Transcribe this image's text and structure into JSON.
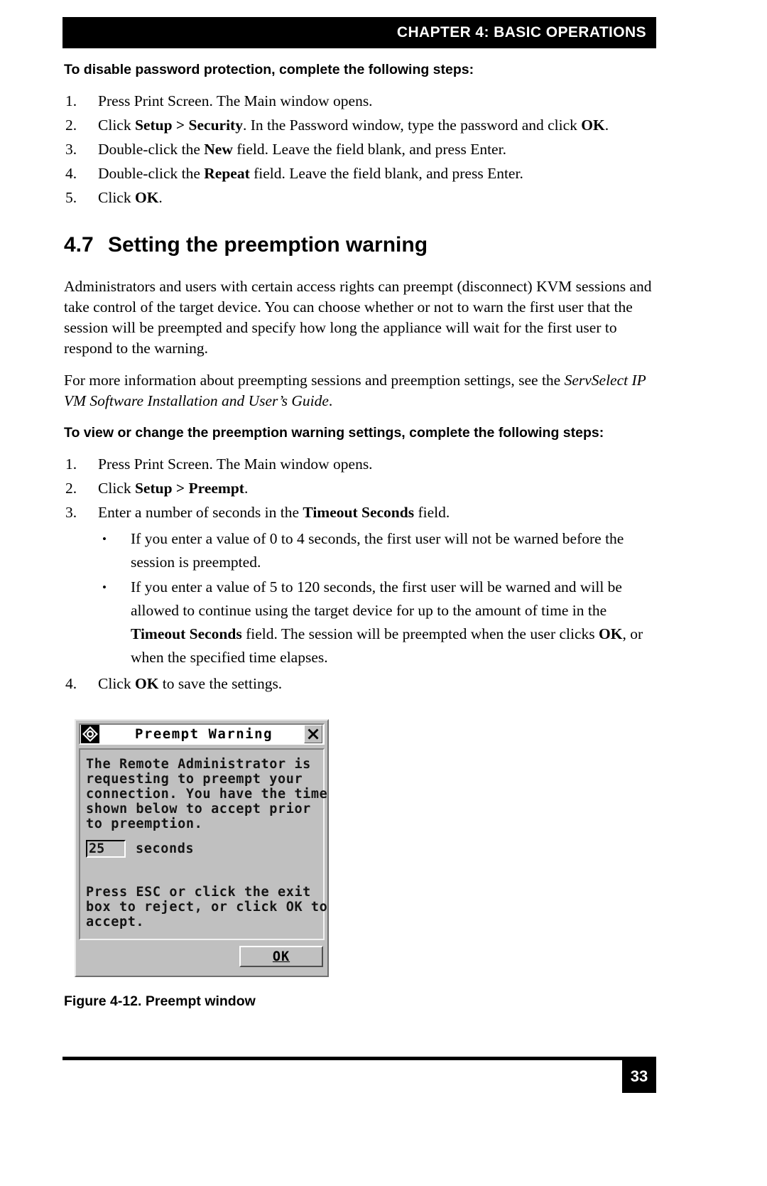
{
  "header": {
    "chapter_title": "CHAPTER 4: BASIC OPERATIONS"
  },
  "section_password": {
    "heading": "To disable password protection, complete the following steps:",
    "steps": [
      {
        "marker": "1.",
        "pre": "Press Print Screen. The Main window opens.",
        "bold": "",
        "post": ""
      },
      {
        "marker": "2.",
        "pre": "Click ",
        "bold": "Setup > Security",
        "mid": ". In the Password window, type the password and click ",
        "bold2": "OK",
        "post": "."
      },
      {
        "marker": "3.",
        "pre": "Double-click the ",
        "bold": "New",
        "post": " field. Leave the field blank, and press Enter."
      },
      {
        "marker": "4.",
        "pre": "Double-click the ",
        "bold": "Repeat",
        "post": " field. Leave the field blank, and press Enter."
      },
      {
        "marker": "5.",
        "pre": "Click ",
        "bold": "OK",
        "post": "."
      }
    ]
  },
  "section_47": {
    "number": "4.7",
    "title": "Setting the preemption warning",
    "paragraph_1": "Administrators and users with certain access rights can preempt (disconnect) KVM sessions and take control of the target device. You can choose whether or not to warn the first user that the session will be preempted and specify how long the appliance will wait for the first user to respond to the warning.",
    "paragraph_2_pre": "For more information about preempting sessions and preemption settings, see the ",
    "paragraph_2_italic": "ServSelect IP VM Software Installation and User’s Guide",
    "paragraph_2_post": ".",
    "procedure_heading": "To view or change the preemption warning settings, complete the following steps:",
    "steps": [
      {
        "marker": "1.",
        "pre": "Press Print Screen. The Main window opens.",
        "bold": "",
        "post": ""
      },
      {
        "marker": "2.",
        "pre": "Click ",
        "bold": "Setup > Preempt",
        "post": "."
      },
      {
        "marker": "3.",
        "pre": "Enter a number of seconds in the ",
        "bold": "Timeout Seconds",
        "post": " field."
      }
    ],
    "sub_bullets": [
      {
        "bullet": "•",
        "text": "If you enter a value of 0 to 4 seconds, the first user will not be warned before the session is preempted."
      },
      {
        "bullet": "•",
        "pre": "If you enter a value of 5 to 120 seconds, the first user will be warned and will be allowed to continue using the target device for up to the amount of time in the ",
        "bold": "Timeout Seconds",
        "mid": " field. The session will be preempted when the user clicks ",
        "bold2": "OK",
        "post": ", or when the specified time elapses."
      }
    ],
    "final_step": {
      "marker": "4.",
      "pre": "Click ",
      "bold": "OK",
      "post": " to save the settings."
    }
  },
  "dialog": {
    "title": "Preempt Warning",
    "system_icon": "diamond-logo-icon",
    "close_icon": "close-x-icon",
    "message_lines": "The Remote Administrator is\nrequesting to preempt your\nconnection. You have the time\nshown below to accept prior\nto preemption.",
    "timeout_value": "25",
    "timeout_unit": "seconds",
    "instruction_lines": "Press ESC or click the exit\nbox to reject, or click OK to\naccept.",
    "ok_label": "OK"
  },
  "figure": {
    "caption_number": "Figure 4-12.",
    "caption_text": "Preempt window",
    "caption_full": "Figure 4-12.  Preempt window"
  },
  "footer": {
    "page_number": "33"
  },
  "colors": {
    "header_bar": "#000000",
    "header_text": "#ffffff",
    "dialog_face": "#c0c0c0",
    "dialog_titlebar": "#ffffff",
    "page_background": "#ffffff",
    "body_text": "#000000"
  }
}
